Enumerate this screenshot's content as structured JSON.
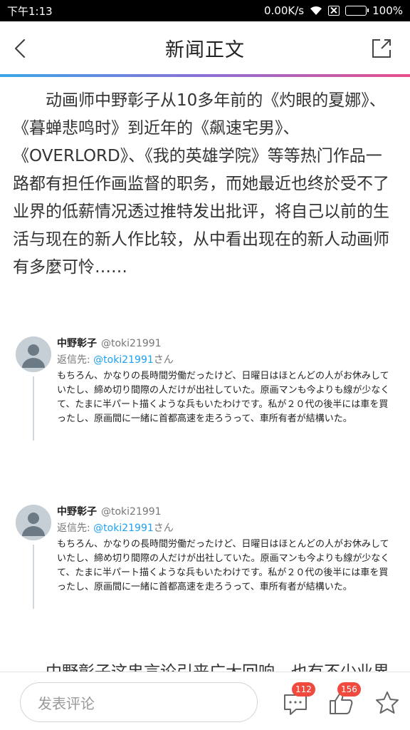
{
  "status": {
    "time": "下午1:13",
    "network_speed": "0.00K/s",
    "battery": "100%"
  },
  "header": {
    "title": "新闻正文"
  },
  "article": {
    "paragraph1": "动画师中野彰子从10多年前的《灼眼的夏娜》、《暮蝉悲鸣时》到近年的《飙速宅男》、《OVERLORD》、《我的英雄学院》等等热门作品一路都有担任作画监督的职务，而她最近也终於受不了业界的低薪情况透过推特发出批评，将自己以前的生活与现在的新人作比较，从中看出现在的新人动画师有多麼可怜……",
    "paragraph2": "中野彰子这串言论引来广大回响，也有不少业界"
  },
  "tweets": [
    {
      "name": "中野彰子",
      "handle": "@toki21991",
      "reply_label": "返信先:",
      "reply_mention": "@toki21991",
      "reply_suffix": "さん",
      "text": "もちろん、かなりの長時間労働だったけど、日曜日はほとんどの人がお休みしていたし、締め切り間際の人だけが出社していた。原画マンも今よりも線が少なくて、たまに半パート描くような兵もいたわけです。私が２０代の後半には車を買ったし、原画間に一緒に首都高速を走ろうって、車所有者が結構いた。"
    },
    {
      "name": "中野彰子",
      "handle": "@toki21991",
      "reply_label": "返信先:",
      "reply_mention": "@toki21991",
      "reply_suffix": "さん",
      "text": "もちろん、かなりの長時間労働だったけど、日曜日はほとんどの人がお休みしていたし、締め切り間際の人だけが出社していた。原画マンも今よりも線が少なくて、たまに半パート描くような兵もいたわけです。私が２０代の後半には車を買ったし、原画間に一緒に首都高速を走ろうって、車所有者が結構いた。"
    }
  ],
  "bottom": {
    "comment_placeholder": "发表评论",
    "comment_count": "112",
    "like_count": "156"
  },
  "icons": {
    "back": "chevron-left-icon",
    "share": "share-icon",
    "comments": "comment-icon",
    "likes": "thumbs-up-icon",
    "favorite": "star-icon"
  },
  "colors": {
    "accent_gradient_start": "#3aa6e8",
    "accent_gradient_end": "#e84e8a",
    "badge": "#f04a3f",
    "mention": "#1da1f2"
  }
}
